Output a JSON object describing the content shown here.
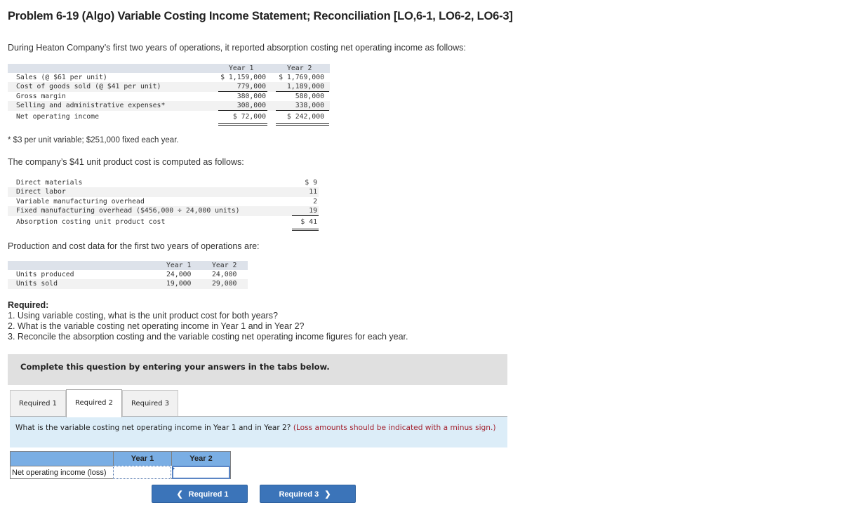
{
  "title": "Problem 6-19 (Algo) Variable Costing Income Statement; Reconciliation [LO,6-1, LO6-2, LO6-3]",
  "intro": "During Heaton Company’s first two years of operations, it reported absorption costing net operating income as follows:",
  "income_statement": {
    "headers": [
      "Year 1",
      "Year 2"
    ],
    "rows": [
      {
        "label": "Sales (@ $61 per unit)",
        "year1": "$ 1,159,000",
        "year2": "$ 1,769,000"
      },
      {
        "label": "Cost of goods sold (@ $41 per unit)",
        "year1": "779,000",
        "year2": "1,189,000"
      },
      {
        "label": "Gross margin",
        "year1": "380,000",
        "year2": "580,000"
      },
      {
        "label": "Selling and administrative expenses*",
        "year1": "308,000",
        "year2": "338,000"
      },
      {
        "label": "Net operating income",
        "year1": "$ 72,000",
        "year2": "$ 242,000"
      }
    ]
  },
  "footnote": "* $3 per unit variable; $251,000 fixed each year.",
  "unit_cost_intro": "The company’s $41 unit product cost is computed as follows:",
  "unit_cost": {
    "rows": [
      {
        "label": "Direct materials",
        "value": "$ 9"
      },
      {
        "label": "Direct labor",
        "value": "11"
      },
      {
        "label": "Variable manufacturing overhead",
        "value": "2"
      },
      {
        "label": "Fixed manufacturing overhead ($456,000 ÷ 24,000 units)",
        "value": "19"
      },
      {
        "label": "Absorption costing unit product cost",
        "value": "$ 41"
      }
    ]
  },
  "production_intro": "Production and cost data for the first two years of operations are:",
  "production": {
    "headers": [
      "Year 1",
      "Year 2"
    ],
    "rows": [
      {
        "label": "Units produced",
        "year1": "24,000",
        "year2": "24,000"
      },
      {
        "label": "Units sold",
        "year1": "19,000",
        "year2": "29,000"
      }
    ]
  },
  "required": {
    "heading": "Required:",
    "items": [
      "1. Using variable costing, what is the unit product cost for both years?",
      "2. What is the variable costing net operating income in Year 1 and in Year 2?",
      "3. Reconcile the absorption costing and the variable costing net operating income figures for each year."
    ]
  },
  "instruction": "Complete this question by entering your answers in the tabs below.",
  "tabs": [
    {
      "label": "Required 1",
      "active": false
    },
    {
      "label": "Required 2",
      "active": true
    },
    {
      "label": "Required 3",
      "active": false
    }
  ],
  "question": {
    "text": "What is the variable costing net operating income in Year 1 and in Year 2?",
    "note": "(Loss amounts should be indicated with a minus sign.)"
  },
  "answer_table": {
    "headers": [
      "Year 1",
      "Year 2"
    ],
    "row_label": "Net operating income (loss)",
    "year1_value": "",
    "year2_value": ""
  },
  "nav": {
    "prev_label": "Required 1",
    "next_label": "Required 3",
    "prev_icon": "chevron-left-icon",
    "next_icon": "chevron-right-icon"
  },
  "colors": {
    "button_blue": "#3b74b9",
    "answer_header": "#7aaee4",
    "question_bg": "#dcedf8",
    "note_red": "#a3222f"
  }
}
